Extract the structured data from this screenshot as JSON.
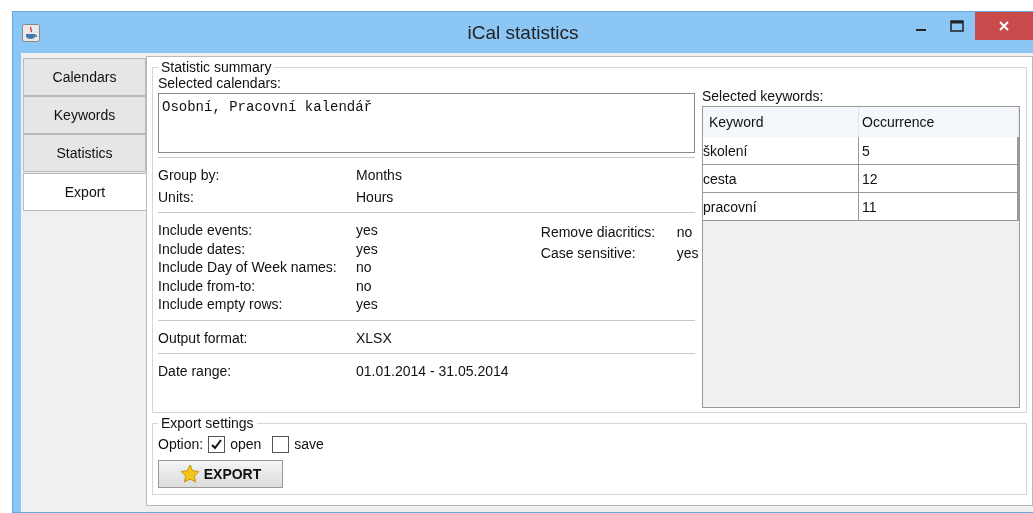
{
  "window": {
    "title": "iCal statistics"
  },
  "tabs": [
    {
      "label": "Calendars",
      "selected": false
    },
    {
      "label": "Keywords",
      "selected": false
    },
    {
      "label": "Statistics",
      "selected": false
    },
    {
      "label": "Export",
      "selected": true
    }
  ],
  "summary": {
    "title": "Statistic summary",
    "calendars_label": "Selected calendars:",
    "calendars": "Osobní, Pracovní kalendář",
    "grouping": [
      {
        "label": "Group by:",
        "value": "Months"
      },
      {
        "label": "Units:",
        "value": "Hours"
      }
    ],
    "includes": [
      {
        "label": "Include events:",
        "value": "yes"
      },
      {
        "label": "Include dates:",
        "value": "yes"
      },
      {
        "label": "Include Day of Week names:",
        "value": "no"
      },
      {
        "label": "Include from-to:",
        "value": "no"
      },
      {
        "label": "Include empty rows:",
        "value": "yes"
      }
    ],
    "text_options": [
      {
        "label": "Remove diacritics:",
        "value": "no"
      },
      {
        "label": "Case sensitive:",
        "value": "yes"
      }
    ],
    "output": [
      {
        "label": "Output format:",
        "value": "XLSX"
      }
    ],
    "range": [
      {
        "label": "Date range:",
        "value": "01.01.2014 - 31.05.2014"
      }
    ],
    "keywords_label": "Selected keywords:",
    "keyword_columns": [
      "Keyword",
      "Occurrence"
    ],
    "keywords": [
      [
        "školení",
        "5"
      ],
      [
        "cesta",
        "12"
      ],
      [
        "pracovní",
        "11"
      ]
    ]
  },
  "export": {
    "title": "Export settings",
    "option_label": "Option:",
    "options": [
      {
        "label": "open",
        "checked": true
      },
      {
        "label": "save",
        "checked": false
      }
    ],
    "button": "EXPORT"
  }
}
